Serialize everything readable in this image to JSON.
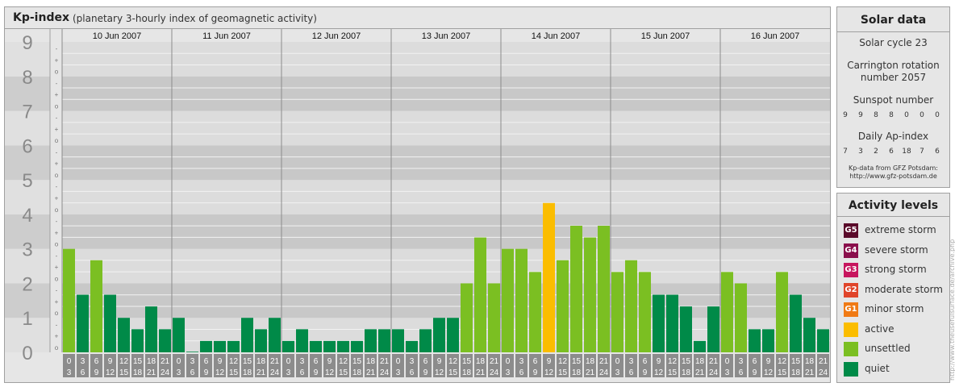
{
  "main": {
    "title": "Kp-index",
    "subtitle": "(planetary 3-hourly index of geomagnetic activity)"
  },
  "chart_data": {
    "type": "bar",
    "title": "Kp-index",
    "subtitle": "(planetary 3-hourly index of geomagnetic activity)",
    "ylim": [
      0,
      9
    ],
    "y_ticks": [
      "0",
      "1",
      "2",
      "3",
      "4",
      "5",
      "6",
      "7",
      "8",
      "9"
    ],
    "minor_ticks": [
      "-",
      "o",
      "+"
    ],
    "days": [
      "10 Jun 2007",
      "11 Jun 2007",
      "12 Jun 2007",
      "13 Jun 2007",
      "14 Jun 2007",
      "15 Jun 2007",
      "16 Jun 2007"
    ],
    "interval_start": [
      "0",
      "3",
      "6",
      "9",
      "12",
      "15",
      "18",
      "21"
    ],
    "interval_end": [
      "3",
      "6",
      "9",
      "12",
      "15",
      "18",
      "21",
      "24"
    ],
    "values": [
      [
        3,
        1.67,
        2.67,
        1.67,
        1,
        0.67,
        1.33,
        0.67
      ],
      [
        1,
        0,
        0.33,
        0.33,
        0.33,
        1,
        0.67,
        1
      ],
      [
        0.33,
        0.67,
        0.33,
        0.33,
        0.33,
        0.33,
        0.67,
        0.67
      ],
      [
        0.67,
        0.33,
        0.67,
        1,
        1,
        2,
        3.33,
        2
      ],
      [
        3,
        3,
        2.33,
        4.33,
        2.67,
        3.67,
        3.33,
        3.67
      ],
      [
        2.33,
        2.67,
        2.33,
        1.67,
        1.67,
        1.33,
        0.33,
        1.33
      ],
      [
        2.33,
        2,
        0.67,
        0.67,
        2.33,
        1.67,
        1,
        0.67
      ]
    ],
    "grid": true,
    "colors": {
      "quiet": "#008a48",
      "unsettled": "#7bbf22",
      "active": "#fbbd00",
      "band_light": "#dcdcdc",
      "band_dark": "#c8c8c8",
      "axis_number": "#8a8a8a"
    }
  },
  "solar": {
    "title": "Solar data",
    "cycle": "Solar cycle 23",
    "carrington_line1": "Carrington rotation",
    "carrington_line2": "number 2057",
    "sunspot_title": "Sunspot number",
    "sunspot_values": [
      "9",
      "9",
      "8",
      "8",
      "0",
      "0",
      "0"
    ],
    "ap_title": "Daily Ap-index",
    "ap_values": [
      "7",
      "3",
      "2",
      "6",
      "18",
      "7",
      "6"
    ],
    "credit_line1": "Kp-data from GFZ Potsdam:",
    "credit_line2": "http://www.gfz-potsdam.de"
  },
  "activity": {
    "title": "Activity levels",
    "levels": [
      {
        "code": "G5",
        "label": "extreme storm",
        "color": "#5a0a2a"
      },
      {
        "code": "G4",
        "label": "severe storm",
        "color": "#8a0f4c"
      },
      {
        "code": "G3",
        "label": "strong storm",
        "color": "#c7155e"
      },
      {
        "code": "G2",
        "label": "moderate storm",
        "color": "#e0442a"
      },
      {
        "code": "G1",
        "label": "minor storm",
        "color": "#f07a14"
      },
      {
        "code": "",
        "label": "active",
        "color": "#fbbd00"
      },
      {
        "code": "",
        "label": "unsettled",
        "color": "#7bbf22"
      },
      {
        "code": "",
        "label": "quiet",
        "color": "#008a48"
      }
    ]
  },
  "watermark": "http://www.theusefulsurface.de/archive.php"
}
